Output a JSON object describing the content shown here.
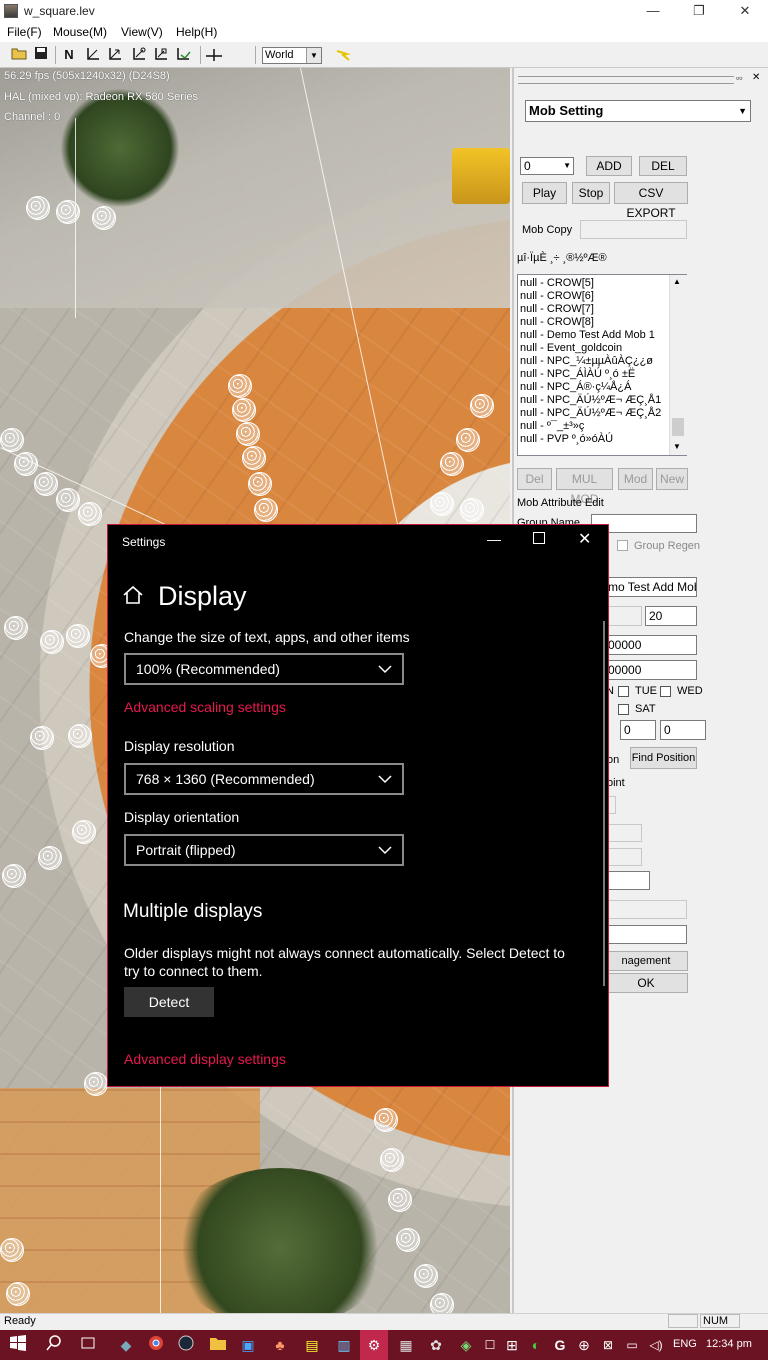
{
  "window": {
    "title": "w_square.lev",
    "min": "—",
    "max": "❐",
    "close": "✕"
  },
  "menu": [
    "File(F)",
    "Mouse(M)",
    "View(V)",
    "Help(H)"
  ],
  "toolbar": {
    "world_value": "World",
    "n_label": "N"
  },
  "viewport": {
    "fps": "56.29 fps (505x1240x32) (D24S8)",
    "hal": "HAL (mixed vp): Radeon RX 580 Series",
    "channel": "Channel :   0"
  },
  "panel": {
    "pin": "▫▫",
    "close": "✕",
    "setting_select": "Mob Setting",
    "index_value": "0",
    "add": "ADD",
    "del": "DEL",
    "play": "Play",
    "stop": "Stop",
    "csv_export": "CSV EXPORT",
    "mob_copy": "Mob Copy",
    "garbled_label": "µî·ÏµÈ ¸÷ ¸®½ºÆ®",
    "list": [
      "null - CROW[5]",
      "null - CROW[6]",
      "null - CROW[7]",
      "null - CROW[8]",
      "null - Demo Test Add Mob 1",
      "null - Event_goldcoin",
      "null - NPC_¼±µµÀûÀÇ¿¿ø",
      "null - NPC_ÁÌÀÚ º¸ó ±Ë",
      "null - NPC_Á®·ç¼Å¿Á",
      "null - NPC_ÄÚ½ºÆ¬ ÆÇ¸Å1",
      "null - NPC_ÄÚ½ºÆ¬ ÆÇ¸Å2",
      "null - º¯_±³»ç",
      "null - PVP º¸ó»óÀÚ"
    ],
    "btn_del": "Del",
    "btn_mul_mod": "MUL MOD",
    "btn_mod": "Mod",
    "btn_new": "New",
    "attr_edit": "Mob Attribute Edit",
    "group_name": "Group Name",
    "group_regen": "Group Regen",
    "mob_name_partial": "mo Test Add Mob",
    "num_20": "20",
    "val_a": "00000",
    "val_b": "00000",
    "day_n": "N",
    "day_tue": "TUE",
    "day_wed": "WED",
    "day_sat": "SAT",
    "pos_x": "0",
    "pos_y": "0",
    "on_partial": "on",
    "find_position": "Find Position",
    "oint_partial": "oint",
    "management_partial": "nagement",
    "ok": "OK"
  },
  "settings": {
    "title": "Settings",
    "heading": "Display",
    "scale_label": "Change the size of text, apps, and other items",
    "scale_value": "100% (Recommended)",
    "advanced_scaling": "Advanced scaling settings",
    "resolution_label": "Display resolution",
    "resolution_value": "768 × 1360 (Recommended)",
    "orientation_label": "Display orientation",
    "orientation_value": "Portrait (flipped)",
    "multiple_heading": "Multiple displays",
    "multiple_desc": "Older displays might not always connect automatically. Select Detect to try to connect to them.",
    "detect": "Detect",
    "advanced_display": "Advanced display settings"
  },
  "statusbar": {
    "ready": "Ready",
    "num": "NUM"
  },
  "taskbar": {
    "lang": "ENG",
    "time": "12:34 pm"
  },
  "colors": {
    "accent": "#e8194d",
    "taskbar": "#6b1323",
    "dialog_border": "#c21b3a"
  }
}
